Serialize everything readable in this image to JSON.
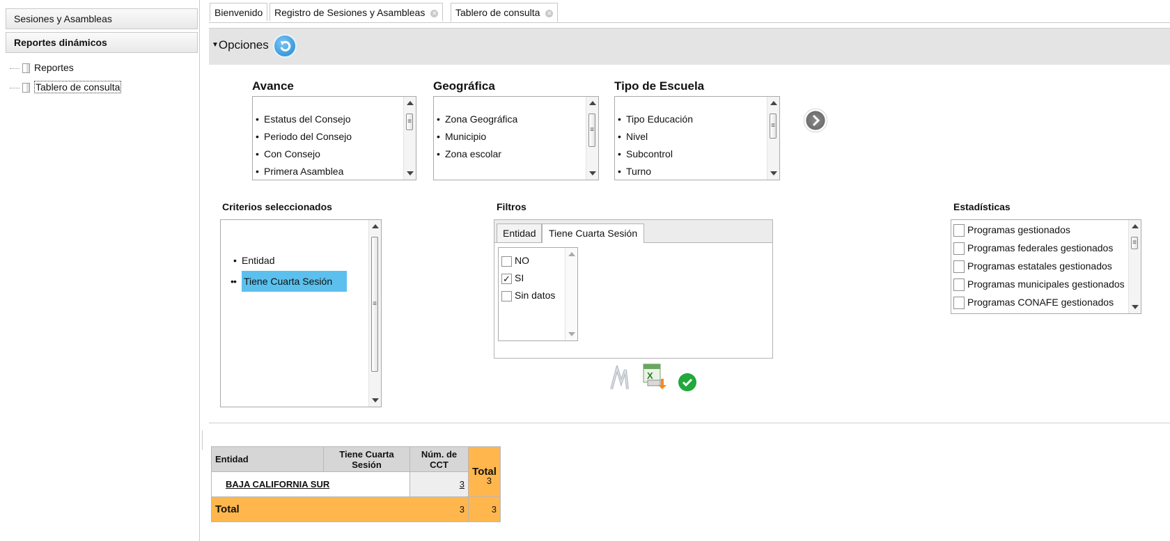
{
  "sidebar": {
    "headers": [
      "Sesiones y Asambleas",
      "Reportes dinámicos"
    ],
    "items": [
      {
        "label": "Reportes"
      },
      {
        "label": "Tablero de consulta"
      }
    ]
  },
  "tabs": [
    {
      "label": "Bienvenido"
    },
    {
      "label": "Registro de Sesiones y Asambleas"
    },
    {
      "label": "Tablero de consulta"
    }
  ],
  "options": {
    "title": "Opciones",
    "refresh_icon": "refresh-icon"
  },
  "avance": {
    "title": "Avance",
    "items": [
      "Estatus del Consejo",
      "Periodo del Consejo",
      "Con Consejo",
      "Primera Asamblea"
    ]
  },
  "geografica": {
    "title": "Geográfica",
    "items": [
      "Zona Geográfica",
      "Municipio",
      "Zona escolar"
    ]
  },
  "tipo_escuela": {
    "title": "Tipo de Escuela",
    "items": [
      "Tipo Educación",
      "Nivel",
      "Subcontrol",
      "Turno"
    ]
  },
  "criterios": {
    "title": "Criterios seleccionados",
    "items": [
      "Entidad",
      "Tiene Cuarta Sesión"
    ]
  },
  "filtros": {
    "title": "Filtros",
    "tabs": [
      "Entidad",
      "Tiene Cuarta Sesión"
    ],
    "options": [
      {
        "label": "NO",
        "checked": false
      },
      {
        "label": "SI",
        "checked": true
      },
      {
        "label": "Sin datos",
        "checked": false
      }
    ]
  },
  "estadisticas": {
    "title": "Estadísticas",
    "items": [
      "Programas gestionados",
      "Programas federales gestionados",
      "Programas estatales gestionados",
      "Programas municipales gestionados",
      "Programas CONAFE gestionados"
    ]
  },
  "results": {
    "headers": [
      "Entidad",
      "Tiene Cuarta Sesión",
      "Núm. de CCT",
      "Total"
    ],
    "rows": [
      {
        "entidad": "BAJA CALIFORNIA SUR",
        "num_cct": "3",
        "total": "3"
      }
    ],
    "total_row": {
      "label": "Total",
      "num_cct": "3",
      "total": "3"
    }
  },
  "colors": {
    "accent_orange": "#ffb74d",
    "selection_blue": "#5bc0ee",
    "button_blue": "#2a93d5",
    "ok_green": "#22a83c"
  }
}
